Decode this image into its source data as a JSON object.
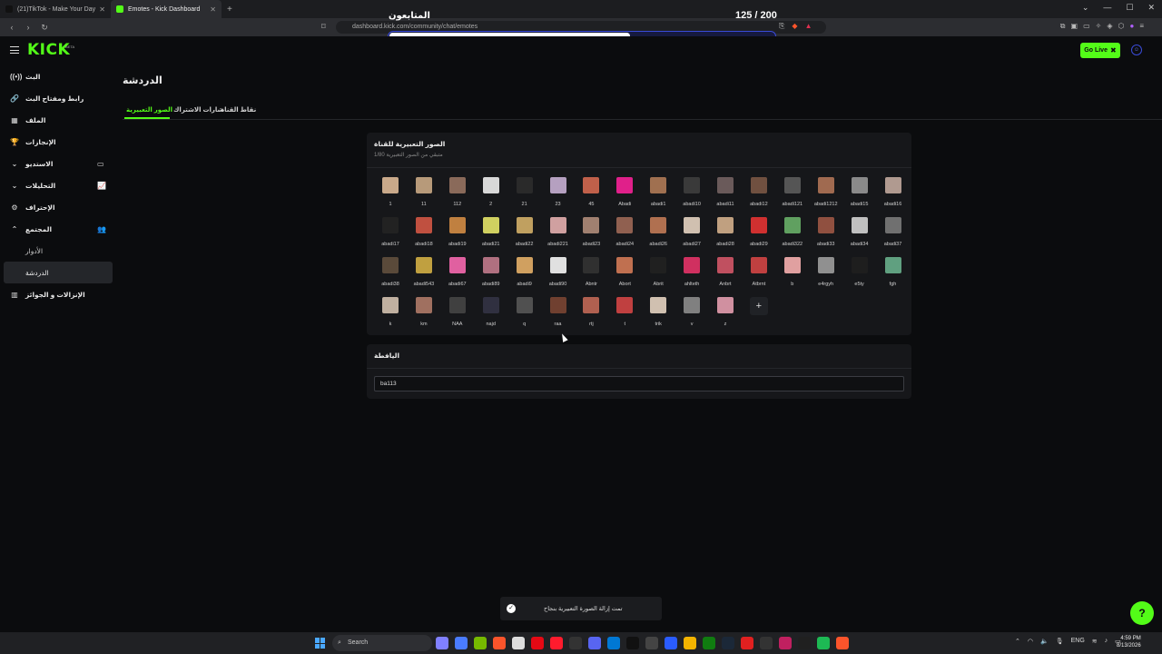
{
  "browser": {
    "tabs": [
      {
        "label": "(21)TikTok - Make Your Day",
        "color": "#111111",
        "active": false
      },
      {
        "label": "Emotes - Kick Dashboard",
        "color": "#53fc18",
        "active": true
      }
    ],
    "new_tab": "+",
    "window_controls": [
      "⌄",
      "—",
      "☐",
      "✕"
    ],
    "url": "dashboard.kick.com/community/chat/emotes"
  },
  "overlay": {
    "label": "المتابعون",
    "count": "125 / 200",
    "progress": 0.625
  },
  "header": {
    "logo": "KICK",
    "beta": "BETA",
    "go_live": "Go Live"
  },
  "sidebar": {
    "items": [
      {
        "label": "البث",
        "icon": "broadcast-icon",
        "glyph": "((•))",
        "sub": false
      },
      {
        "label": "رابط ومفتاح البث",
        "icon": "link-icon",
        "glyph": "🔗",
        "sub": false
      },
      {
        "label": "الملف",
        "icon": "profile-icon",
        "glyph": "▦",
        "sub": false
      },
      {
        "label": "الإنجازات",
        "icon": "trophy-icon",
        "glyph": "🏆",
        "sub": false
      },
      {
        "label": "الاستديو",
        "icon": "chevron-down-icon",
        "glyph": "⌄",
        "right": "▭",
        "sub": false
      },
      {
        "label": "التحليلات",
        "icon": "chevron-down-icon",
        "glyph": "⌄",
        "right": "📈",
        "sub": false
      },
      {
        "label": "الإحتراف",
        "icon": "sparkle-icon",
        "glyph": "⚙",
        "sub": false
      },
      {
        "label": "المجتمع",
        "icon": "chevron-up-icon",
        "glyph": "⌃",
        "right": "👥",
        "sub": false
      },
      {
        "label": "الأدوار",
        "icon": "",
        "glyph": "",
        "sub": true
      },
      {
        "label": "الدردشة",
        "icon": "",
        "glyph": "",
        "sub": true,
        "selected": true
      },
      {
        "label": "الإنزالات و الجوائز",
        "icon": "gift-icon",
        "glyph": "▥",
        "sub": false
      }
    ]
  },
  "page": {
    "title": "الدردشة",
    "tabs": [
      "الصور التعبيرية",
      "شارات الاشتراك",
      "نقاط القناة"
    ]
  },
  "emotes_card": {
    "title": "الصور التعبيرية للقناة",
    "subtitle": "1/80 متبقي من الصور التعبيرية",
    "add_label": "+",
    "emotes": [
      {
        "name": "1",
        "color": "#c9a98a"
      },
      {
        "name": "11",
        "color": "#b79a7a"
      },
      {
        "name": "112",
        "color": "#8a6a5a"
      },
      {
        "name": "2",
        "color": "#d8d8d8"
      },
      {
        "name": "21",
        "color": "#2a2a2a"
      },
      {
        "name": "23",
        "color": "#b5a0c0"
      },
      {
        "name": "45",
        "color": "#c0604a"
      },
      {
        "name": "Abadi",
        "color": "#e0208a"
      },
      {
        "name": "abadi1",
        "color": "#a07050"
      },
      {
        "name": "abadi10",
        "color": "#3a3a3a"
      },
      {
        "name": "abadi11",
        "color": "#6a5a5a"
      },
      {
        "name": "abadi12",
        "color": "#705040"
      },
      {
        "name": "abadi121",
        "color": "#555555"
      },
      {
        "name": "abadi1212",
        "color": "#a06a50"
      },
      {
        "name": "abadi15",
        "color": "#8a8a8a"
      },
      {
        "name": "abadi16",
        "color": "#b09a90"
      },
      {
        "name": "abadi17",
        "color": "#222222"
      },
      {
        "name": "abadi18",
        "color": "#c05040"
      },
      {
        "name": "abadi19",
        "color": "#c08040"
      },
      {
        "name": "abadi21",
        "color": "#d0d060"
      },
      {
        "name": "abadi22",
        "color": "#c0a060"
      },
      {
        "name": "abadi221",
        "color": "#d0a0a0"
      },
      {
        "name": "abadi23",
        "color": "#a08070"
      },
      {
        "name": "abadi24",
        "color": "#906050"
      },
      {
        "name": "abadi26",
        "color": "#b07050"
      },
      {
        "name": "abadi27",
        "color": "#d0c0b0"
      },
      {
        "name": "abadi28",
        "color": "#c0a080"
      },
      {
        "name": "abadi29",
        "color": "#d03030"
      },
      {
        "name": "abadi322",
        "color": "#60a060"
      },
      {
        "name": "abadi33",
        "color": "#905040"
      },
      {
        "name": "abadi34",
        "color": "#c0c0c0"
      },
      {
        "name": "abadi37",
        "color": "#707070"
      },
      {
        "name": "abadi38",
        "color": "#5a4a3a"
      },
      {
        "name": "abadi543",
        "color": "#c0a040"
      },
      {
        "name": "abadi67",
        "color": "#e060a0"
      },
      {
        "name": "abadi89",
        "color": "#b07080"
      },
      {
        "name": "abadi9",
        "color": "#d0a060"
      },
      {
        "name": "abadi90",
        "color": "#e0e0e0"
      },
      {
        "name": "Abntr",
        "color": "#303030"
      },
      {
        "name": "Abort",
        "color": "#c07050"
      },
      {
        "name": "Abrit",
        "color": "#202020"
      },
      {
        "name": "ahlteth",
        "color": "#d03060"
      },
      {
        "name": "Anbrt",
        "color": "#c05060"
      },
      {
        "name": "Atbrnt",
        "color": "#c04040"
      },
      {
        "name": "b",
        "color": "#e0a0a0"
      },
      {
        "name": "e4rgyh",
        "color": "#909090"
      },
      {
        "name": "e5ty",
        "color": "#1e1e1e"
      },
      {
        "name": "fgh",
        "color": "#60a080"
      },
      {
        "name": "k",
        "color": "#c0b0a0"
      },
      {
        "name": "km",
        "color": "#a07060"
      },
      {
        "name": "NAA",
        "color": "#404040"
      },
      {
        "name": "najd",
        "color": "#303040"
      },
      {
        "name": "q",
        "color": "#505050"
      },
      {
        "name": "raa",
        "color": "#704030"
      },
      {
        "name": "rtj",
        "color": "#b06050"
      },
      {
        "name": "t",
        "color": "#c04040"
      },
      {
        "name": "trik",
        "color": "#d0c0b0"
      },
      {
        "name": "v",
        "color": "#808080"
      },
      {
        "name": "z",
        "color": "#d090a0"
      }
    ]
  },
  "name_card": {
    "title": "اليافطة",
    "value": "ba113"
  },
  "toast": {
    "message": "تمت إزالة الصورة التعبيرية بنجاح",
    "check": "✓"
  },
  "help": "?",
  "taskbar": {
    "search": "Search",
    "apps": [
      {
        "name": "widgets",
        "color": "#8080ff"
      },
      {
        "name": "copilot",
        "color": "#4a7cff"
      },
      {
        "name": "nvidia",
        "color": "#76b900"
      },
      {
        "name": "brave",
        "color": "#fb542b"
      },
      {
        "name": "chrome",
        "color": "#dddddd"
      },
      {
        "name": "netflix",
        "color": "#e50914"
      },
      {
        "name": "opera",
        "color": "#ff1b2d"
      },
      {
        "name": "obs",
        "color": "#333333"
      },
      {
        "name": "discord",
        "color": "#5865f2"
      },
      {
        "name": "store",
        "color": "#0078d4"
      },
      {
        "name": "tiktok",
        "color": "#111111"
      },
      {
        "name": "app",
        "color": "#444444"
      },
      {
        "name": "vpn",
        "color": "#2a5cff"
      },
      {
        "name": "files",
        "color": "#f4b400"
      },
      {
        "name": "xbox",
        "color": "#107c10"
      },
      {
        "name": "steam",
        "color": "#1b2838"
      },
      {
        "name": "app2",
        "color": "#e02020"
      },
      {
        "name": "capcut",
        "color": "#333333"
      },
      {
        "name": "app3",
        "color": "#c02060"
      },
      {
        "name": "app4",
        "color": "#202020"
      },
      {
        "name": "spotify",
        "color": "#1db954"
      },
      {
        "name": "brave2",
        "color": "#fb542b"
      }
    ],
    "language": "ENG",
    "time": "4:59 PM",
    "date": "8/13/2026"
  }
}
